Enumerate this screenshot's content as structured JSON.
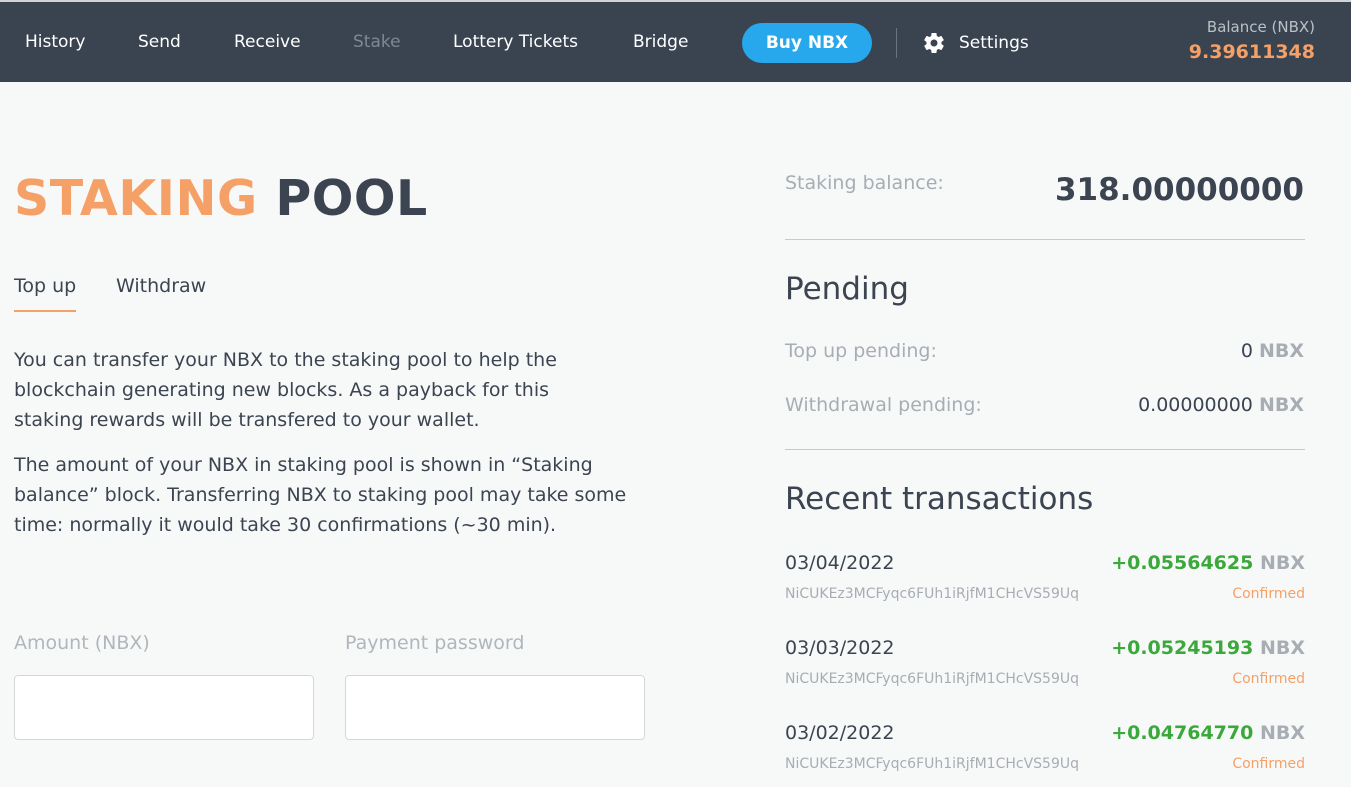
{
  "nav": {
    "items": [
      {
        "label": "History",
        "enabled": true
      },
      {
        "label": "Send",
        "enabled": true
      },
      {
        "label": "Receive",
        "enabled": true
      },
      {
        "label": "Stake",
        "enabled": false
      },
      {
        "label": "Lottery Tickets",
        "enabled": true
      },
      {
        "label": "Bridge",
        "enabled": true
      }
    ],
    "buy_label": "Buy NBX",
    "settings_label": "Settings",
    "settings_icon": "gear-icon",
    "balance_label": "Balance (NBX)",
    "balance_value": "9.39611348"
  },
  "title": {
    "part1": "STAKING",
    "part2": "POOL"
  },
  "tabs": [
    {
      "label": "Top up",
      "active": true
    },
    {
      "label": "Withdraw",
      "active": false
    }
  ],
  "description": [
    "You can transfer your NBX to the staking pool to help the blockchain generating new blocks. As a payback for this staking rewards will be transfered to your wallet.",
    "The amount of your NBX in staking pool is shown in “Staking balance” block. Transferring NBX to staking pool may take some time: normally it would take 30 confirmations (~30 min)."
  ],
  "form": {
    "amount_label": "Amount (NBX)",
    "amount_value": "",
    "password_label": "Payment password",
    "password_value": ""
  },
  "staking": {
    "balance_label": "Staking balance:",
    "balance_value": "318.00000000"
  },
  "pending": {
    "title": "Pending",
    "topup_label": "Top up pending:",
    "topup_value": "0",
    "withdrawal_label": "Withdrawal pending:",
    "withdrawal_value": "0.00000000",
    "unit": "NBX"
  },
  "recent": {
    "title": "Recent transactions",
    "transactions": [
      {
        "date": "03/04/2022",
        "amount": "+0.05564625",
        "unit": "NBX",
        "address": "NiCUKEz3MCFyqc6FUh1iRjfM1CHcVS59Uq",
        "status": "Confirmed"
      },
      {
        "date": "03/03/2022",
        "amount": "+0.05245193",
        "unit": "NBX",
        "address": "NiCUKEz3MCFyqc6FUh1iRjfM1CHcVS59Uq",
        "status": "Confirmed"
      },
      {
        "date": "03/02/2022",
        "amount": "+0.04764770",
        "unit": "NBX",
        "address": "NiCUKEz3MCFyqc6FUh1iRjfM1CHcVS59Uq",
        "status": "Confirmed"
      }
    ]
  },
  "colors": {
    "nav_bg": "#3a4450",
    "accent_orange": "#f5a067",
    "buy_blue": "#28a8ec",
    "positive_green": "#3ba83b"
  }
}
